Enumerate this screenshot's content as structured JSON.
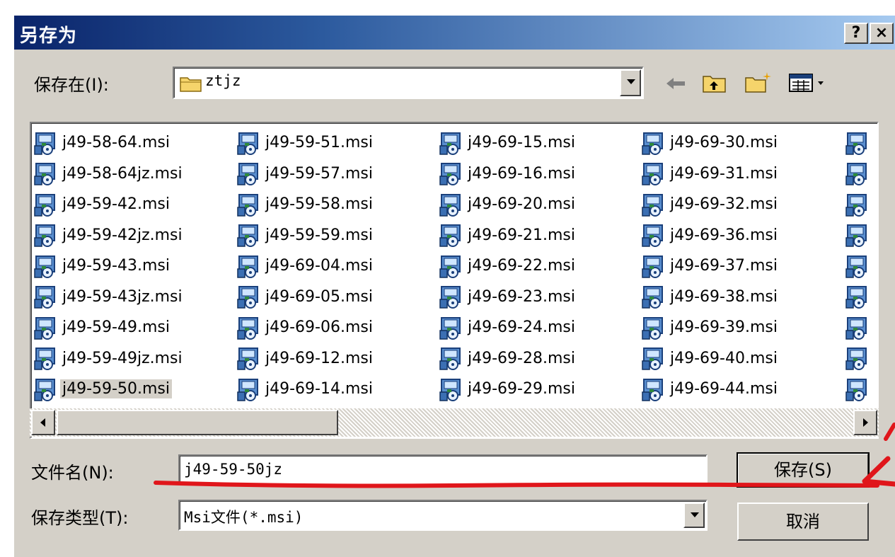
{
  "window": {
    "title": "另存为",
    "help_label": "?",
    "close_label": "×"
  },
  "save_in": {
    "label": "保存在(I):",
    "value": "ztjz"
  },
  "file_columns": [
    [
      "j49-58-64.msi",
      "j49-58-64jz.msi",
      "j49-59-42.msi",
      "j49-59-42jz.msi",
      "j49-59-43.msi",
      "j49-59-43jz.msi",
      "j49-59-49.msi",
      "j49-59-49jz.msi",
      "j49-59-50.msi"
    ],
    [
      "j49-59-51.msi",
      "j49-59-57.msi",
      "j49-59-58.msi",
      "j49-59-59.msi",
      "j49-69-04.msi",
      "j49-69-05.msi",
      "j49-69-06.msi",
      "j49-69-12.msi",
      "j49-69-14.msi"
    ],
    [
      "j49-69-15.msi",
      "j49-69-16.msi",
      "j49-69-20.msi",
      "j49-69-21.msi",
      "j49-69-22.msi",
      "j49-69-23.msi",
      "j49-69-24.msi",
      "j49-69-28.msi",
      "j49-69-29.msi"
    ],
    [
      "j49-69-30.msi",
      "j49-69-31.msi",
      "j49-69-32.msi",
      "j49-69-36.msi",
      "j49-69-37.msi",
      "j49-69-38.msi",
      "j49-69-39.msi",
      "j49-69-40.msi",
      "j49-69-44.msi"
    ],
    [
      "",
      "",
      "",
      "",
      "",
      "",
      "",
      "",
      ""
    ]
  ],
  "selected_file": "j49-59-50.msi",
  "file_name": {
    "label": "文件名(N):",
    "value": "j49-59-50jz"
  },
  "file_type": {
    "label": "保存类型(T):",
    "value": "Msi文件(*.msi)"
  },
  "buttons": {
    "save": "保存(S)",
    "cancel": "取消"
  },
  "icons": {
    "file": "msi-file-icon",
    "folder": "folder-icon",
    "back": "back-arrow-icon",
    "up": "up-folder-icon",
    "new_folder": "new-folder-icon",
    "view": "view-menu-icon"
  },
  "colors": {
    "title_start": "#0a246a",
    "title_end": "#a6caf0",
    "face": "#d4d0c8",
    "annotation": "#e0161b"
  }
}
